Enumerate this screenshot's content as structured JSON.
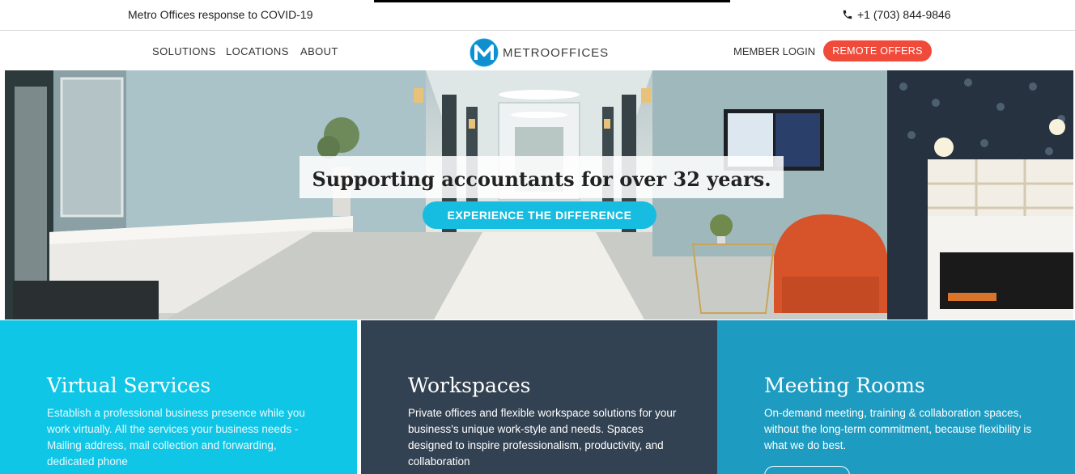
{
  "topbar": {
    "covid_text": "Metro Offices response to COVID-19",
    "phone": "+1 (703) 844-9846",
    "phone_icon": "phone-icon"
  },
  "nav": {
    "links": [
      "SOLUTIONS",
      "LOCATIONS",
      "ABOUT"
    ],
    "logo_text": "METROOFFICES",
    "member_login": "MEMBER LOGIN",
    "cta": "REMOTE OFFERS"
  },
  "hero": {
    "title": "Supporting accountants for over 32 years.",
    "button": "EXPERIENCE THE DIFFERENCE"
  },
  "services": [
    {
      "title": "Virtual Services",
      "description": "Establish a professional business presence while you work virtually. All the services your business needs - Mailing address, mail collection and forwarding, dedicated phone"
    },
    {
      "title": "Workspaces",
      "description": "Private offices and flexible workspace solutions for your business's unique work-style and needs. Spaces designed to inspire professionalism, productivity, and collaboration"
    },
    {
      "title": "Meeting Rooms",
      "description": "On-demand meeting, training & collaboration spaces, without the long-term commitment, because flexibility is what we do best."
    }
  ],
  "colors": {
    "accent_red": "#f04a3a",
    "accent_cyan": "#17bde0",
    "virtual_bg": "#10c6e6",
    "workspaces_bg": "#334252",
    "meeting_bg": "#1d9bc1"
  }
}
